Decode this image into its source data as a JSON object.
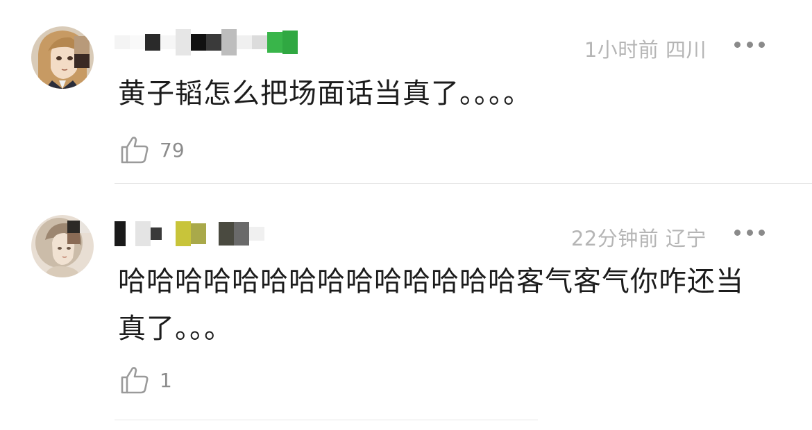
{
  "comments": [
    {
      "username_mosaic": [
        "#f4f4f4",
        "#2a2a2a",
        "#ffffff",
        "#111111",
        "#3a3a3a",
        "#d8d8d8",
        "#f0f0f0",
        "#39b54a"
      ],
      "time": "1小时前",
      "location": "四川",
      "content": "黄子韬怎么把场面话当真了。。。。",
      "likes": "79"
    },
    {
      "username_mosaic": [
        "#1a1a1a",
        "#ffffff",
        "#d0d0d0",
        "#3a3a3a",
        "#c8c43a",
        "#a9a94a",
        "#ffffff",
        "#4a4a40",
        "#6a6a6a"
      ],
      "time": "22分钟前",
      "location": "辽宁",
      "content": "哈哈哈哈哈哈哈哈哈哈哈哈哈哈客气客气你咋还当真了。。。",
      "likes": "1"
    }
  ],
  "colors": {
    "meta": "#b5b5b5",
    "text": "#1c1c1c",
    "divider": "#e6e6e6",
    "icon": "#9a9a9a"
  }
}
